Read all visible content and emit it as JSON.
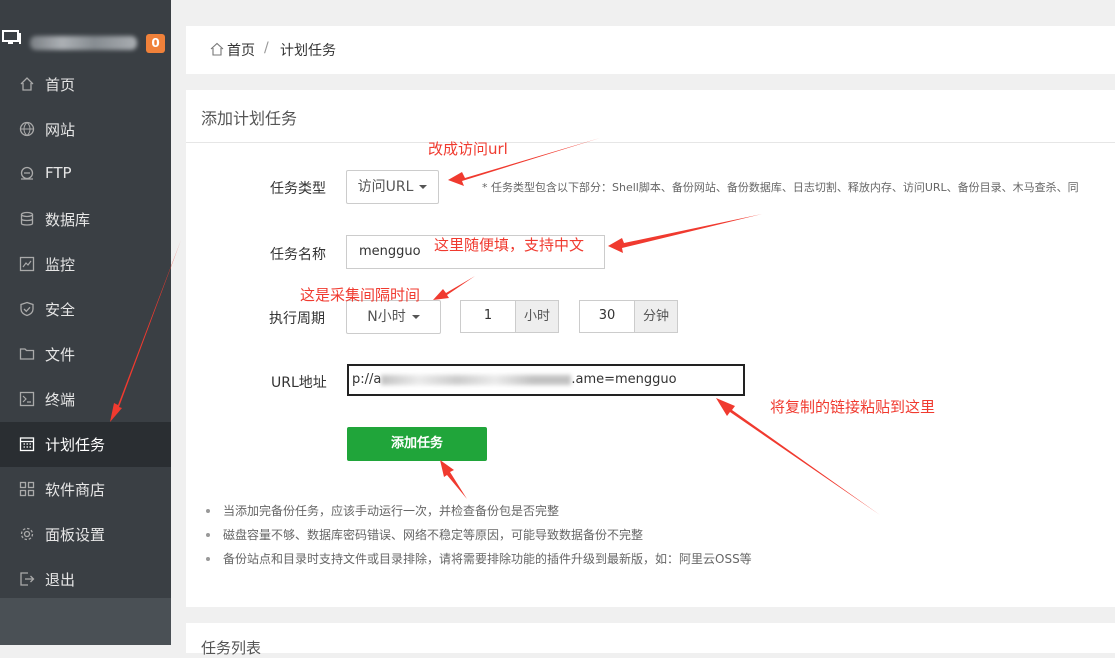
{
  "sidebar": {
    "badge": "0",
    "items": [
      {
        "label": "首页",
        "icon": "home-icon"
      },
      {
        "label": "网站",
        "icon": "globe-icon"
      },
      {
        "label": "FTP",
        "icon": "ftp-icon"
      },
      {
        "label": "数据库",
        "icon": "database-icon"
      },
      {
        "label": "监控",
        "icon": "monitor-icon"
      },
      {
        "label": "安全",
        "icon": "shield-icon"
      },
      {
        "label": "文件",
        "icon": "folder-icon"
      },
      {
        "label": "终端",
        "icon": "terminal-icon"
      },
      {
        "label": "计划任务",
        "icon": "calendar-icon",
        "active": true
      },
      {
        "label": "软件商店",
        "icon": "apps-icon"
      },
      {
        "label": "面板设置",
        "icon": "gear-icon"
      },
      {
        "label": "退出",
        "icon": "logout-icon"
      }
    ]
  },
  "breadcrumb": {
    "home": "首页",
    "separator": "/",
    "current": "计划任务"
  },
  "form": {
    "title": "添加计划任务",
    "task_type_label": "任务类型",
    "task_type_value": "访问URL",
    "task_type_tip": "*  任务类型包含以下部分：Shell脚本、备份网站、备份数据库、日志切割、释放内存、访问URL、备份目录、木马查杀、同",
    "task_name_label": "任务名称",
    "task_name_value": "mengguo",
    "cycle_label": "执行周期",
    "cycle_value": "N小时",
    "hours_value": "1",
    "hours_unit": "小时",
    "minutes_value": "30",
    "minutes_unit": "分钟",
    "url_label": "URL地址",
    "url_prefix": "p://a",
    "url_suffix": ".ame=mengguo",
    "submit_label": "添加任务"
  },
  "notes": [
    "当添加完备份任务，应该手动运行一次，并检查备份包是否完整",
    "磁盘容量不够、数据库密码错误、网络不稳定等原因，可能导致数据备份不完整",
    "备份站点和目录时支持文件或目录排除，请将需要排除功能的插件升级到最新版，如：阿里云OSS等"
  ],
  "task_list_title": "任务列表",
  "annotations": {
    "a1": "改成访问url",
    "a2": "这里随便填，支持中文",
    "a3": "这是采集间隔时间",
    "a4": "将复制的链接粘贴到这里",
    "color": "#f03a2f"
  },
  "colors": {
    "sidebar_bg": "#3a3f44",
    "active_bg": "#2a2e32",
    "badge": "#f0813a",
    "primary_button": "#20a53a"
  }
}
